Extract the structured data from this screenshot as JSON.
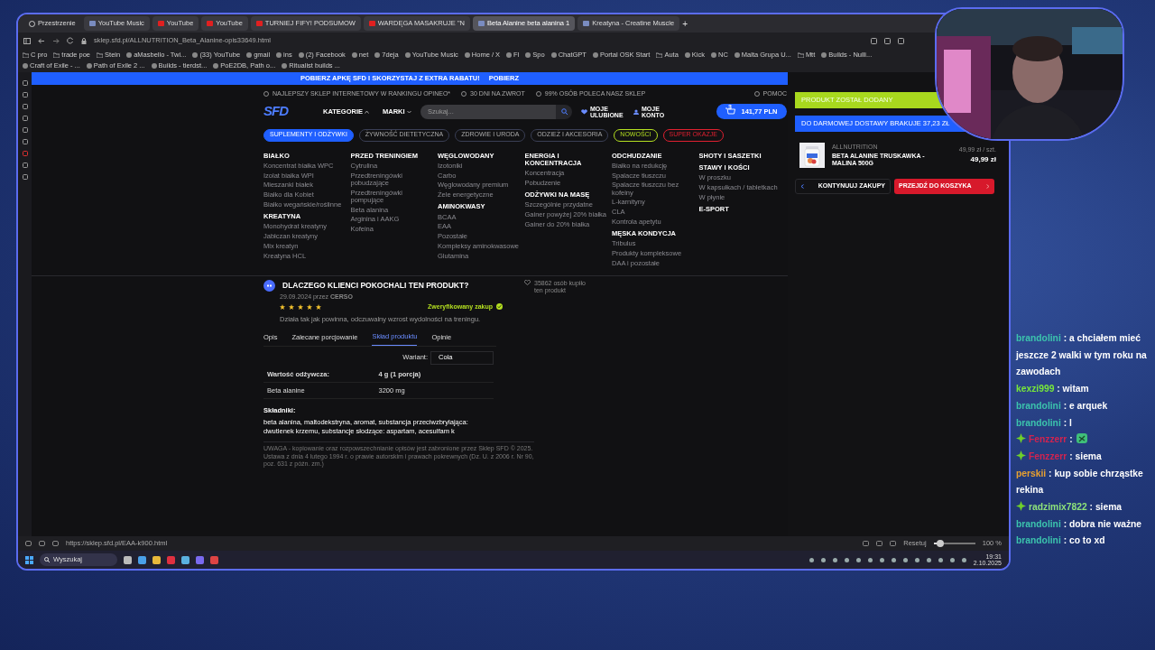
{
  "browser": {
    "space_label": "Przestrzenie",
    "tabs": [
      {
        "label": "YouTube Music",
        "selected": false
      },
      {
        "label": "YouTube",
        "selected": false
      },
      {
        "label": "YouTube",
        "selected": false
      },
      {
        "label": "TURNIEJ FIFY! PODSUMOW",
        "selected": false
      },
      {
        "label": "WARDĘGA MASAKRUJE \"N",
        "selected": false
      },
      {
        "label": "Beta Alanine beta alanina 1",
        "selected": true
      },
      {
        "label": "Kreatyna - Creatine Muscle",
        "selected": false
      }
    ],
    "new_tab": "+",
    "url": "sklep.sfd.pl/ALLNUTRITION_Beta_Alanine-opis33649.html",
    "bookmarks": [
      {
        "label": "C pro",
        "kind": "folder"
      },
      {
        "label": "trade poe",
        "kind": "folder"
      },
      {
        "label": "Stein",
        "kind": "folder"
      },
      {
        "label": "aMasbello - Twi...",
        "kind": "site"
      },
      {
        "label": "(33) YouTube",
        "kind": "site"
      },
      {
        "label": "gmail",
        "kind": "site"
      },
      {
        "label": "ins",
        "kind": "site"
      },
      {
        "label": "(2) Facebook",
        "kind": "site"
      },
      {
        "label": "net",
        "kind": "site"
      },
      {
        "label": "7deja",
        "kind": "site"
      },
      {
        "label": "YouTube Music",
        "kind": "site"
      },
      {
        "label": "Home / X",
        "kind": "site"
      },
      {
        "label": "Fl",
        "kind": "site"
      },
      {
        "label": "Spo",
        "kind": "site"
      },
      {
        "label": "ChatGPT",
        "kind": "site"
      },
      {
        "label": "Portal OSK Start",
        "kind": "site"
      },
      {
        "label": "Auta",
        "kind": "folder"
      },
      {
        "label": "Kick",
        "kind": "site"
      },
      {
        "label": "NC",
        "kind": "site"
      },
      {
        "label": "Malta Grupa U...",
        "kind": "site"
      },
      {
        "label": "Mtt",
        "kind": "folder"
      },
      {
        "label": "Builds - Nulli...",
        "kind": "site"
      },
      {
        "label": "Craft of Exile - ...",
        "kind": "site"
      },
      {
        "label": "Path of Exile 2 ...",
        "kind": "site"
      },
      {
        "label": "Builds - tierdst...",
        "kind": "site"
      },
      {
        "label": "PoE2DB, Path o...",
        "kind": "site"
      },
      {
        "label": "Ritualist builds ...",
        "kind": "site"
      }
    ],
    "status_url": "https://sklep.sfd.pl/EAA-k900.html",
    "reset_label": "Resetuj",
    "zoom": {
      "level": 0.15,
      "reading": "100 %"
    }
  },
  "site": {
    "banner": {
      "text": "POBIERZ APKĘ SFD I SKORZYSTAJ Z EXTRA RABATU!",
      "link": "POBIERZ"
    },
    "info": [
      "NAJLEPSZY SKLEP INTERNETOWY W RANKINGU OPINEO*",
      "30 DNI NA ZWROT",
      "99% OSÓB POLECA NASZ SKLEP"
    ],
    "help": "POMOC",
    "logo": "SFD",
    "nav": [
      "KATEGORIE",
      "MARKI"
    ],
    "search": {
      "placeholder": "Szukaj..."
    },
    "favorites": "MOJE ULUBIONE",
    "account": "MOJE KONTO",
    "cart": {
      "count": "3",
      "total": "141,77 PLN"
    },
    "chips": [
      {
        "label": "SUPLEMENTY I ODŻYWKI",
        "selected": true,
        "color": "#1f5fff"
      },
      {
        "label": "ŻYWNOŚĆ DIETETYCZNA",
        "selected": false,
        "color": "#3a3f55"
      },
      {
        "label": "ZDROWIE I URODA",
        "selected": false,
        "color": "#3a3f55"
      },
      {
        "label": "ODZIEŻ I AKCESORIA",
        "selected": false,
        "color": "#3a3f55"
      },
      {
        "label": "NOWOŚCI",
        "selected": false,
        "color": "#b5e020"
      },
      {
        "label": "SUPER OKAZJE",
        "selected": false,
        "color": "#e02030"
      }
    ],
    "menu": [
      [
        {
          "heading": "BIAŁKO",
          "items": [
            "Koncentrat białka WPC",
            "Izolat białka WPI",
            "Mieszanki białek",
            "Białko dla Kobiet",
            "Białko wegańskie/roślinne"
          ]
        },
        {
          "heading": "KREATYNA",
          "items": [
            "Monohydrat kreatyny",
            "Jabłczan kreatyny",
            "Mix kreatyn",
            "Kreatyna HCL"
          ]
        }
      ],
      [
        {
          "heading": "PRZED TRENINGIEM",
          "items": [
            "Cytrulina",
            "Przedtreningówki pobudzające",
            "Przedtreningówki pompujące",
            "Beta alanina",
            "Arginina i AAKG",
            "Kofeina"
          ]
        }
      ],
      [
        {
          "heading": "WĘGLOWODANY",
          "items": [
            "Izotoniki",
            "Carbo",
            "Węglowodany premium",
            "Żele energetyczne"
          ]
        },
        {
          "heading": "AMINOKWASY",
          "items": [
            "BCAA",
            "EAA",
            "Pozostałe",
            "Kompleksy aminokwasowe",
            "Glutamina"
          ]
        }
      ],
      [
        {
          "heading": "ENERGIA I KONCENTRACJA",
          "items": [
            "Koncentracja",
            "Pobudzenie"
          ]
        },
        {
          "heading": "ODŻYWKI NA MASĘ",
          "items": [
            "Szczególnie przydatne",
            "Gainer powyżej 20% białka",
            "Gainer do 20% białka"
          ]
        }
      ],
      [
        {
          "heading": "ODCHUDZANIE",
          "items": [
            "Białko na redukcję",
            "Spalacze tłuszczu",
            "Spalacze tłuszczu bez kofeiny",
            "L-karnityny",
            "CLA",
            "Kontrola apetytu"
          ]
        },
        {
          "heading": "MĘSKA KONDYCJA",
          "items": [
            "Tribulus",
            "Produkty kompleksowe",
            "DAA i pozostałe"
          ]
        }
      ],
      [
        {
          "heading": "SHOTY I SASZETKI"
        },
        {
          "heading": "STAWY I KOŚCI",
          "items": [
            "W proszku",
            "W kapsułkach / tabletkach",
            "W płynie"
          ]
        },
        {
          "heading": "E-SPORT"
        }
      ]
    ],
    "review": {
      "heading": "DLACZEGO KLIENCI POKOCHALI TEN PRODUKT?",
      "meta": "29.09.2024 przez **CERSO**",
      "stars": 5,
      "verified": "Zweryfikowany zakup",
      "text": "Działa tak jak powinna, odczuwalny wzrost wydolności na treningu.",
      "buyers": "35862 osób kupiło ten produkt"
    },
    "tabs": [
      {
        "label": "Opis",
        "selected": false
      },
      {
        "label": "Zalecane porcjowanie",
        "selected": false
      },
      {
        "label": "Skład produktu",
        "selected": true
      },
      {
        "label": "Opinie",
        "selected": false
      }
    ],
    "variant": {
      "label": "Wariant:",
      "value": "Cola"
    },
    "nutrition": [
      [
        "Wartość odżywcza:",
        "4 g (1 porcja)"
      ],
      [
        "Beta alanine",
        "3200 mg"
      ]
    ],
    "ingredients_heading": "Składniki:",
    "ingredients": "beta alanina, maltodekstryna, aromat, substancja przeciwzbrylająca: dwutlenek krzemu, substancje słodzące: aspartam, acesulfam k",
    "notice": "UWAGA - kopiowanie oraz rozpowszechnianie opisów jest zabronione przez Sklep SFD © 2025. Ustawa z dnia 4 lutego 1994 r. o prawie autorskim i prawach pokrewnych (Dz. U. z 2006 r. Nr 90, poz. 631 z późn. zm.)"
  },
  "cart_panel": {
    "added": "PRODUKT ZOSTAŁ DODANY",
    "shipping": "DO DARMOWEJ DOSTAWY BRAKUJE 37,23 ZŁ",
    "item": {
      "brand": "ALLNUTRITION",
      "name": "BETA ALANINE TRUSKAWKA - MALINA 500G",
      "unit_price": "49,99 zł / szt.",
      "price": "49,99 zł"
    },
    "continue": "KONTYNUUJ ZAKUPY",
    "checkout": "PRZEJDŹ DO KOSZYKA"
  },
  "taskbar": {
    "search": "Wyszukaj",
    "time": "19:31",
    "date": "2.10.2025"
  },
  "chat": [
    {
      "user": "brandolini",
      "sep": ":",
      "color": "#3cc4ad",
      "badge": false,
      "kind": "text",
      "text": "a chciałem mieć jeszcze 2 walki w tym roku na zawodach"
    },
    {
      "user": "kexzi999",
      "sep": ":",
      "color": "#78e83a",
      "badge": false,
      "kind": "text",
      "text": "witam"
    },
    {
      "user": "brandolini",
      "sep": ":",
      "color": "#3cc4ad",
      "badge": false,
      "kind": "text",
      "text": "e arquek"
    },
    {
      "user": "brandolini",
      "sep": ":",
      "color": "#3cc4ad",
      "badge": false,
      "kind": "text",
      "text": "l"
    },
    {
      "user": "Fenzzerr",
      "sep": ":",
      "color": "#d3234f",
      "badge": true,
      "kind": "emote"
    },
    {
      "user": "Fenzzerr",
      "sep": ":",
      "color": "#d3234f",
      "badge": true,
      "kind": "text",
      "text": "siema"
    },
    {
      "user": "perskii",
      "sep": ":",
      "color": "#e8a030",
      "badge": false,
      "kind": "text",
      "text": "kup sobie chrząstke rekina"
    },
    {
      "user": "radzimix7822",
      "sep": ":",
      "color": "#8ee37a",
      "badge": true,
      "kind": "text",
      "text": "siema"
    },
    {
      "user": "brandolini",
      "sep": ":",
      "color": "#3cc4ad",
      "badge": false,
      "kind": "text",
      "text": "dobra nie ważne"
    },
    {
      "user": "brandolini",
      "sep": ":",
      "color": "#3cc4ad",
      "badge": false,
      "kind": "text",
      "text": "co to xd"
    }
  ]
}
